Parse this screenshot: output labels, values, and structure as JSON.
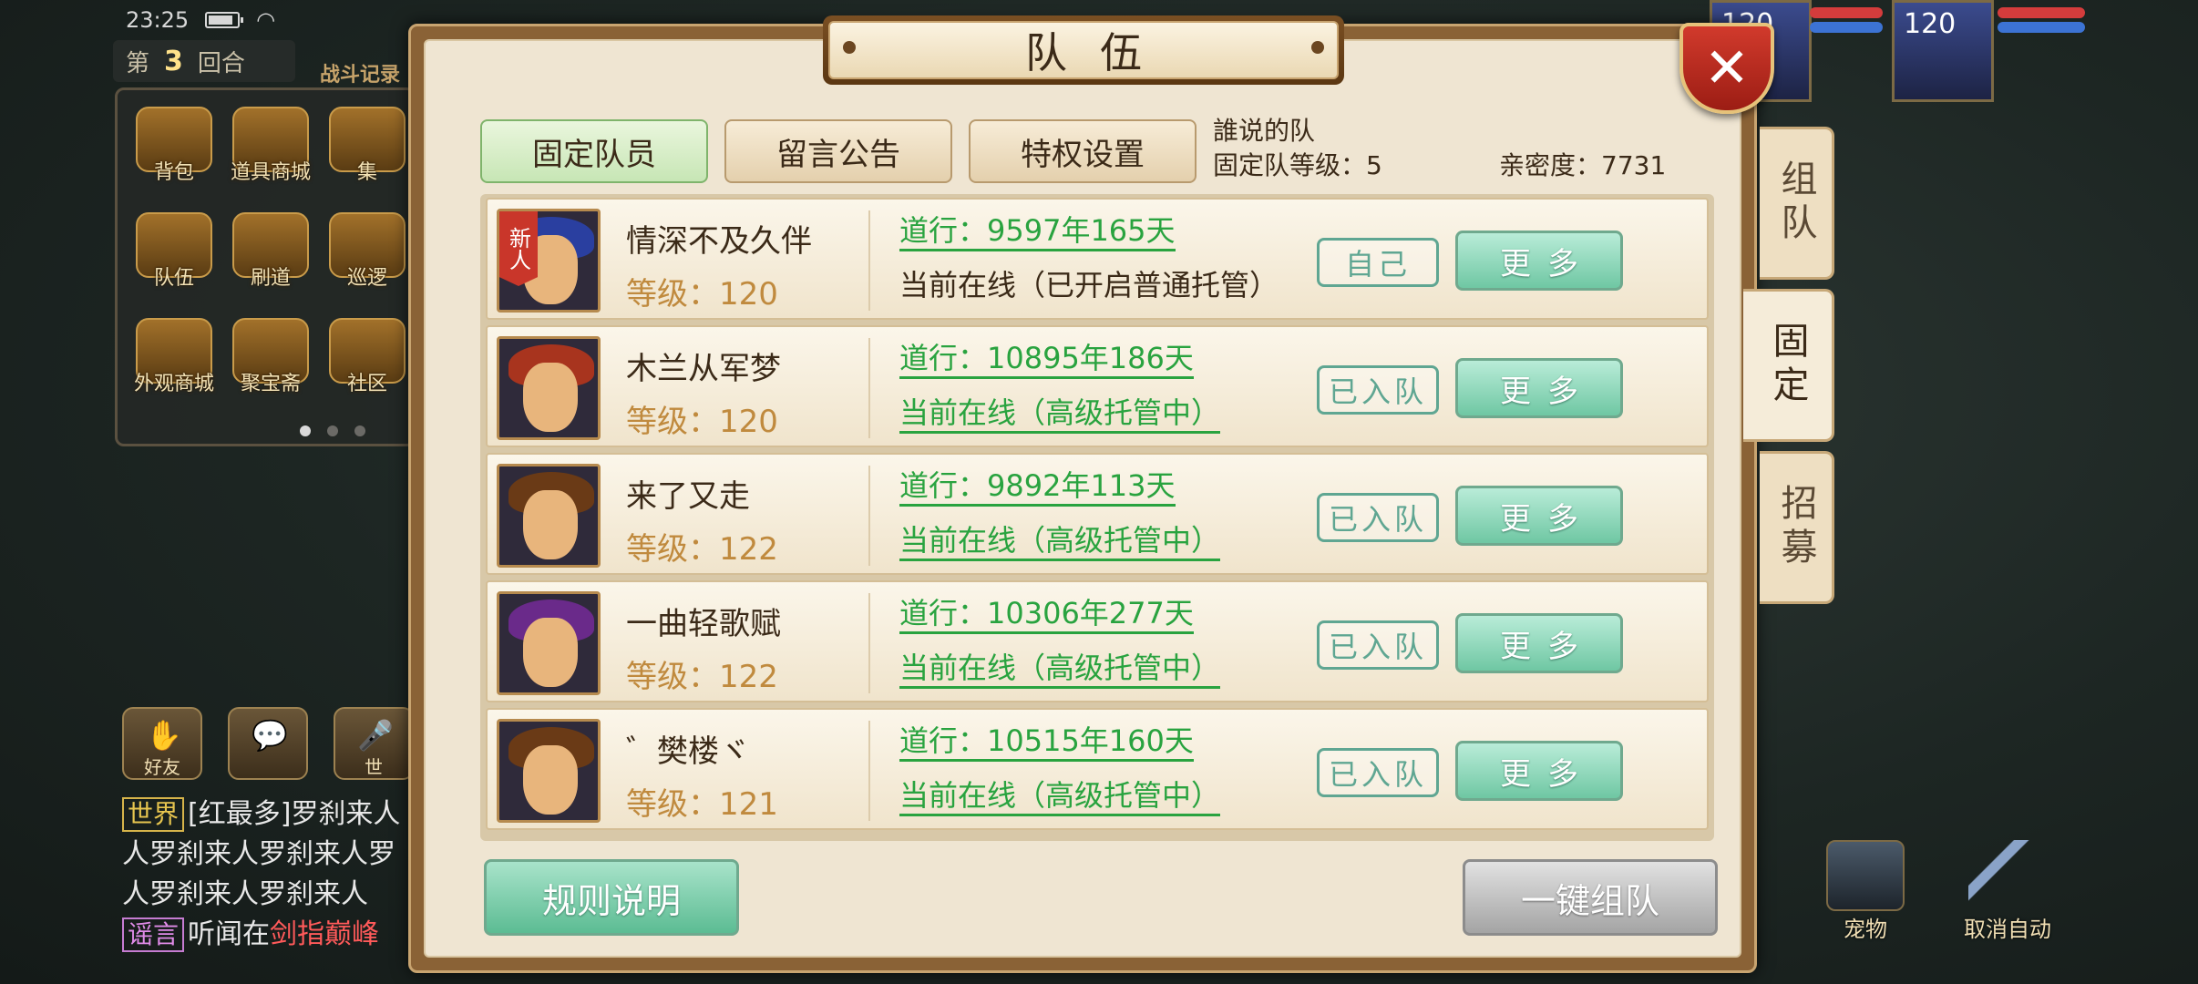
{
  "status_bar": {
    "time": "23:25"
  },
  "round": {
    "prefix": "第",
    "number": "3",
    "suffix": "回合"
  },
  "battle_log_label": "战斗记录",
  "menu": [
    {
      "label": "背包"
    },
    {
      "label": "道具商城"
    },
    {
      "label": "集"
    },
    {
      "label": "队伍"
    },
    {
      "label": "刷道"
    },
    {
      "label": "巡逻"
    },
    {
      "label": "外观商城"
    },
    {
      "label": "聚宝斋"
    },
    {
      "label": "社区"
    }
  ],
  "chat_buttons": {
    "friends": "好友",
    "world": "世"
  },
  "chat": [
    {
      "tag": "世界",
      "text": "[红最多]罗刹来人"
    },
    {
      "tag": "",
      "text": "人罗刹来人罗刹来人罗"
    },
    {
      "tag": "",
      "text": "人罗刹来人罗刹来人"
    },
    {
      "tag": "谣言",
      "text_prefix": "听闻在",
      "text_red": "剑指巅峰"
    }
  ],
  "top_right": {
    "level_a": "120",
    "level_b": "120"
  },
  "bottom_right": {
    "pet": "宠物",
    "cancel_auto": "取消自动"
  },
  "dialog": {
    "title": "队伍",
    "close": "✕",
    "side_tabs": [
      "组队",
      "固定",
      "招募"
    ],
    "tabs": [
      "固定队员",
      "留言公告",
      "特权设置"
    ],
    "team_name": "誰说的队",
    "team_level": "固定队等级：5",
    "intimacy": "亲密度：7731",
    "members": [
      {
        "name": "情深不及久伴",
        "level": "等级：120",
        "dao": "道行：9597年165天",
        "status": "当前在线（已开启普通托管）",
        "tag": "自己",
        "more": "更多",
        "new": "新人",
        "hair": "#2a3fa0"
      },
      {
        "name": "木兰从军梦",
        "level": "等级：120",
        "dao": "道行：10895年186天",
        "status": "当前在线（高级托管中）",
        "tag": "已入队",
        "more": "更多",
        "new": "",
        "hair": "#a8341e"
      },
      {
        "name": "来了又走",
        "level": "等级：122",
        "dao": "道行：9892年113天",
        "status": "当前在线（高级托管中）",
        "tag": "已入队",
        "more": "更多",
        "new": "",
        "hair": "#6a3a16"
      },
      {
        "name": "一曲轻歌赋",
        "level": "等级：122",
        "dao": "道行：10306年277天",
        "status": "当前在线（高级托管中）",
        "tag": "已入队",
        "more": "更多",
        "new": "",
        "hair": "#6a2a8a"
      },
      {
        "name": "゛樊楼ヾ",
        "level": "等级：121",
        "dao": "道行：10515年160天",
        "status": "当前在线（高级托管中）",
        "tag": "已入队",
        "more": "更多",
        "new": "",
        "hair": "#6a3a16"
      }
    ],
    "rules_button": "规则说明",
    "auto_team_button": "一键组队"
  }
}
